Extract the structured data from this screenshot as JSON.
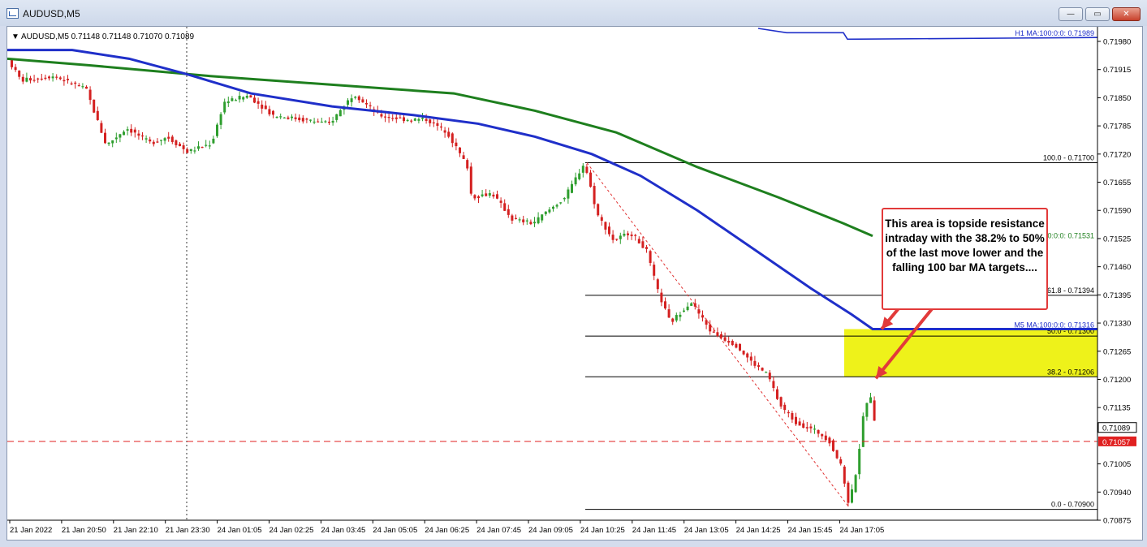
{
  "window": {
    "title": "AUDUSD,M5",
    "buttons": {
      "minimize": "—",
      "maximize": "▭",
      "close": "✕"
    }
  },
  "chart_data": {
    "type": "candlestick",
    "symbol_header": "AUDUSD,M5  0.71148 0.71148 0.71070 0.71089",
    "colors": {
      "up": "#2e9e2e",
      "down": "#d42020",
      "ma_m5_100": "#1f2fc9",
      "ma_m5_200": "#1e7f1e",
      "ma_h1_100": "#1f2fc9",
      "fib": "#000000",
      "highlight": "#eef21a",
      "price_line": "#e02020"
    },
    "y_ticks": [
      "0.71980",
      "0.71915",
      "0.71850",
      "0.71785",
      "0.71720",
      "0.71655",
      "0.71590",
      "0.71525",
      "0.71460",
      "0.71395",
      "0.71330",
      "0.71265",
      "0.71200",
      "0.71135",
      "0.71005",
      "0.70940",
      "0.70875"
    ],
    "x_ticks": [
      "21 Jan 2022",
      "21 Jan 20:50",
      "21 Jan 22:10",
      "21 Jan 23:30",
      "24 Jan 01:05",
      "24 Jan 02:25",
      "24 Jan 03:45",
      "24 Jan 05:05",
      "24 Jan 06:25",
      "24 Jan 07:45",
      "24 Jan 09:05",
      "24 Jan 10:25",
      "24 Jan 11:45",
      "24 Jan 13:05",
      "24 Jan 14:25",
      "24 Jan 15:45",
      "24 Jan 17:05"
    ],
    "fib_levels": [
      {
        "label": "100.0 - 0.71700",
        "value": 0.717
      },
      {
        "label": "61.8 - 0.71394",
        "value": 0.71394
      },
      {
        "label": "50.0 - 0.71300",
        "value": 0.713
      },
      {
        "label": "38.2 - 0.71206",
        "value": 0.71206
      },
      {
        "label": "0.0 - 0.70900",
        "value": 0.709
      }
    ],
    "ma_labels": {
      "h1_100": "H1 MA:100:0:0: 0.71989",
      "m5_200": "200:0:0: 0.71531",
      "m5_100": "M5 MA:100:0:0: 0.71316"
    },
    "price_labels": {
      "current": "0.71089",
      "line": "0.71057"
    },
    "current_price": 0.71089,
    "price_line": 0.71057,
    "resistance_zone": [
      0.71206,
      0.71316
    ],
    "annotation": "This area is topside resistance intraday with the 38.2% to 50% of the last move lower and the falling 100 bar MA targets...."
  }
}
